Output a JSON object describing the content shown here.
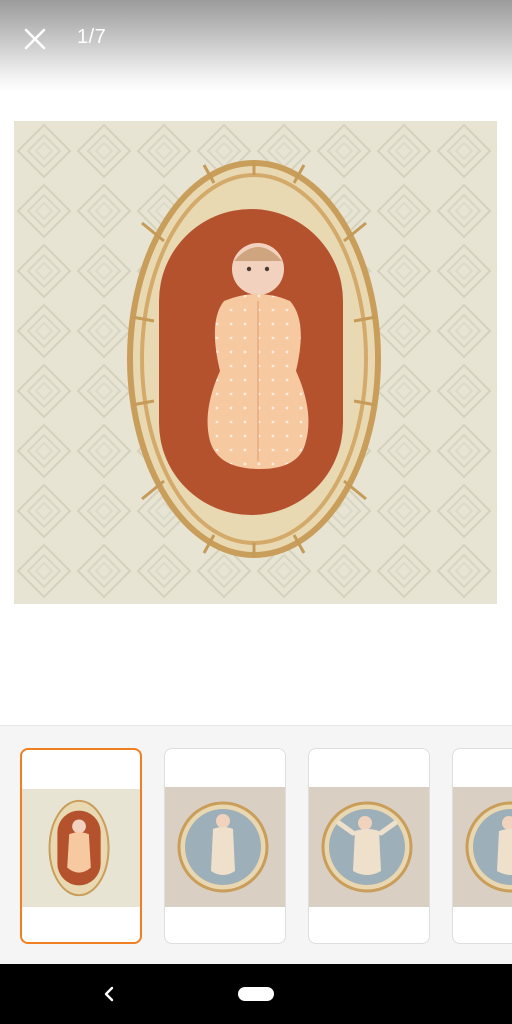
{
  "viewer": {
    "counter": "1/7"
  },
  "icons": {
    "close": "close-icon",
    "back": "back-chevron-icon",
    "home": "home-pill-icon"
  },
  "thumbnails": [
    {
      "label": "thumbnail-1",
      "selected": true
    },
    {
      "label": "thumbnail-2",
      "selected": false
    },
    {
      "label": "thumbnail-3",
      "selected": false
    },
    {
      "label": "thumbnail-4",
      "selected": false
    }
  ],
  "colors": {
    "accent": "#f07f22",
    "mattress": "#b8532f",
    "swaddle": "#f5c8a2",
    "rug": "#e6e2d2"
  }
}
